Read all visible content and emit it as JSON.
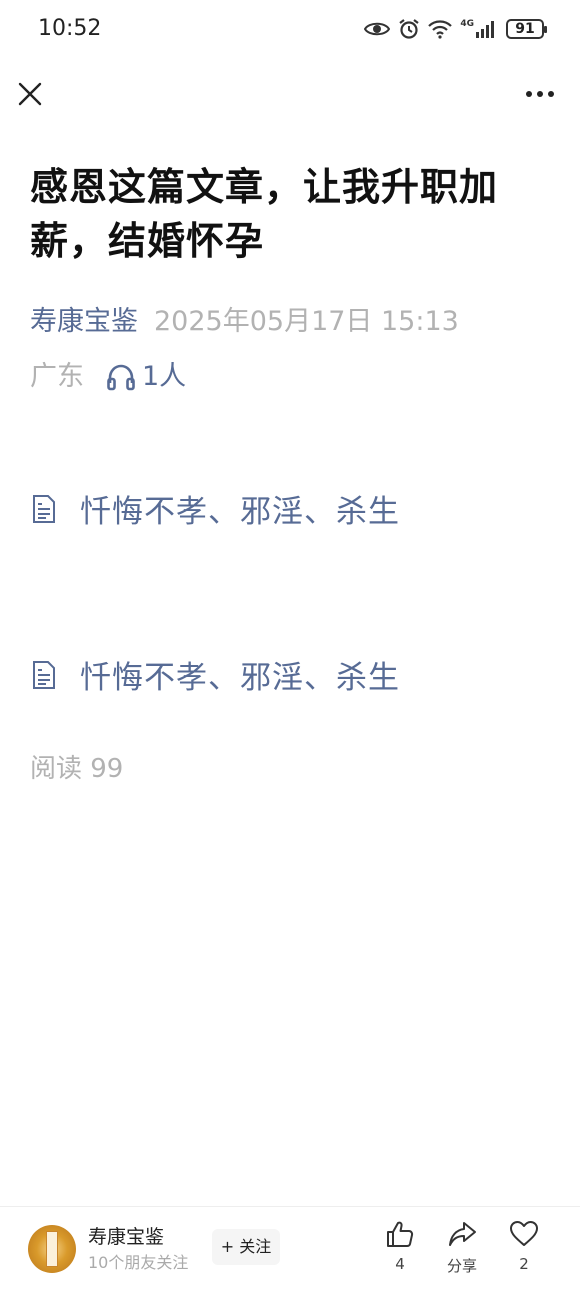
{
  "status_bar": {
    "time": "10:52",
    "network": "4G",
    "battery": "91"
  },
  "top_bar": {
    "close_icon": "close-icon",
    "more_icon": "more-icon"
  },
  "article": {
    "title": "感恩这篇文章，让我升职加薪，结婚怀孕",
    "author": "寿康宝鉴",
    "date": "2025年05月17日 15:13",
    "location": "广东",
    "listeners": "1人",
    "links": [
      {
        "text": "忏悔不孝、邪淫、杀生"
      },
      {
        "text": "忏悔不孝、邪淫、杀生"
      }
    ],
    "read_count": "阅读 99"
  },
  "bottom_bar": {
    "account_name": "寿康宝鉴",
    "followers": "10个朋友关注",
    "follow_label": "+ 关注",
    "like_count": "4",
    "share_label": "分享",
    "favorite_count": "2"
  },
  "colors": {
    "link": "#576b95",
    "muted": "#b2b2b2"
  }
}
